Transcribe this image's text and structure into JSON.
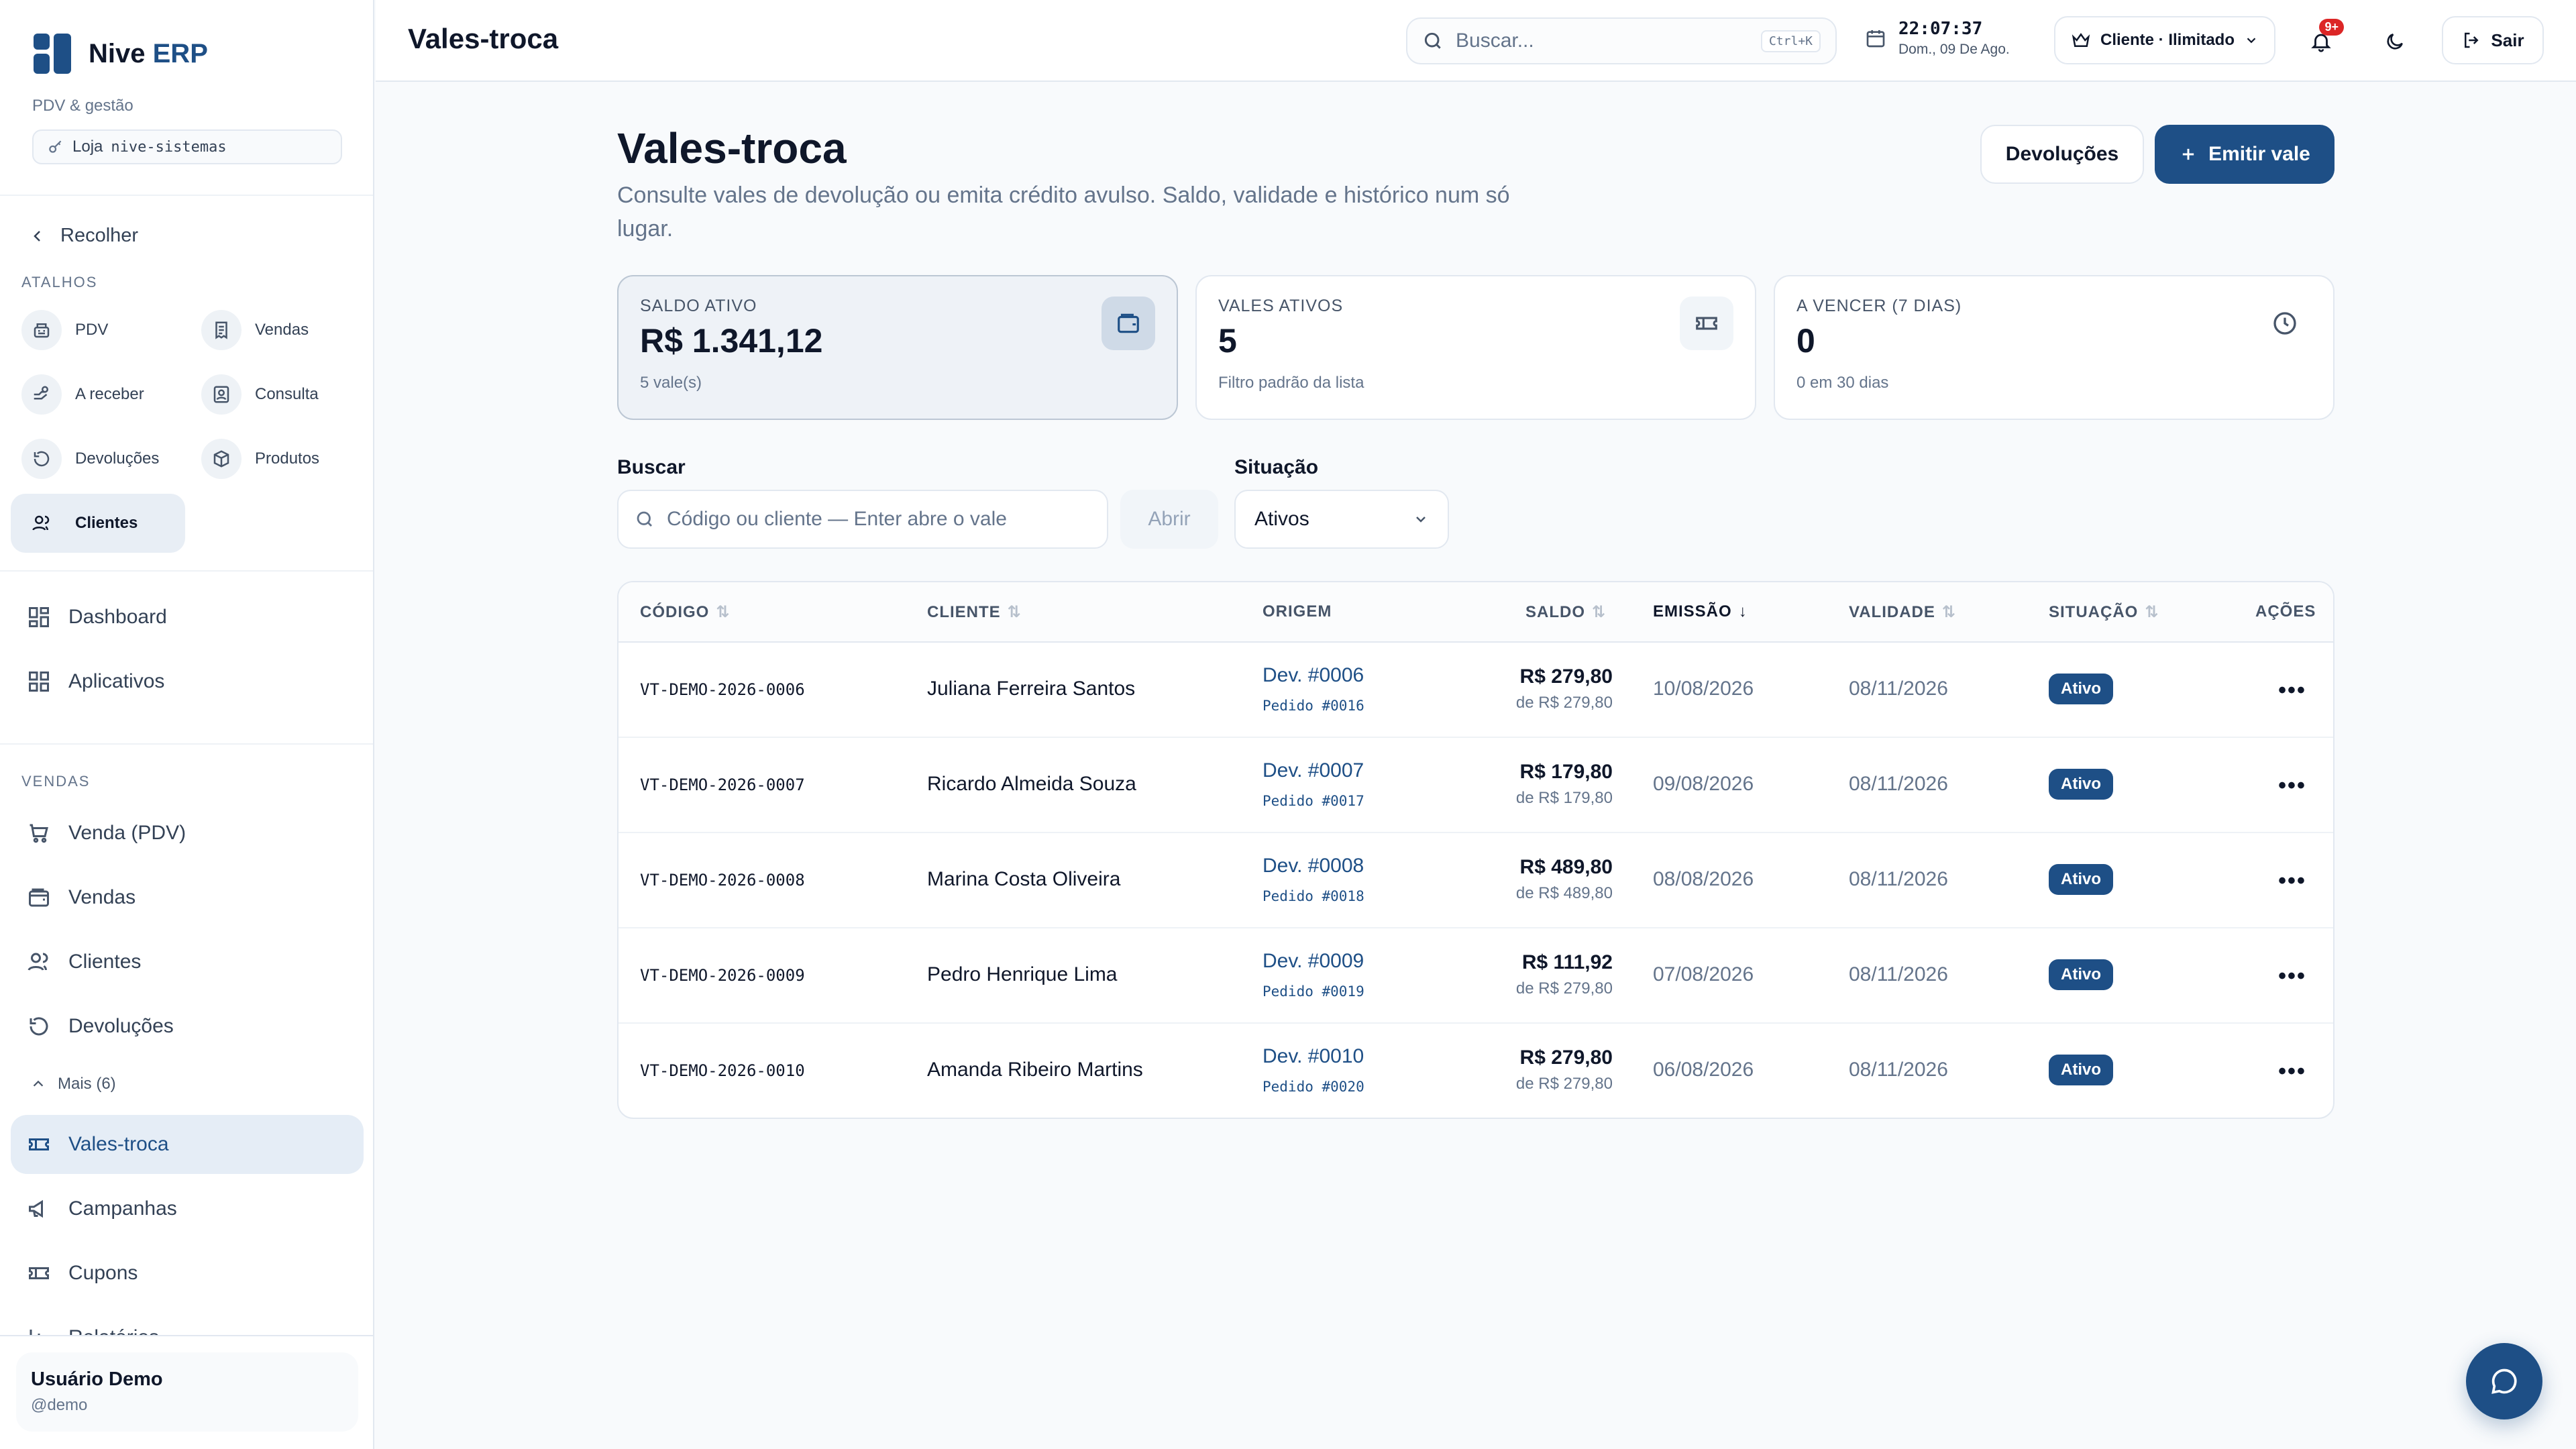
{
  "brand": {
    "name": "Nive",
    "name_accent": "ERP",
    "subtitle": "PDV & gestão",
    "store_label": "Loja",
    "store_value": "nive-sistemas"
  },
  "sidebar": {
    "collapse_label": "Recolher",
    "shortcuts_label": "ATALHOS",
    "shortcuts": [
      {
        "label": "PDV",
        "icon": "register-icon"
      },
      {
        "label": "Vendas",
        "icon": "receipt-icon"
      },
      {
        "label": "A receber",
        "icon": "money-icon"
      },
      {
        "label": "Consulta",
        "icon": "badge-icon"
      },
      {
        "label": "Devoluções",
        "icon": "return-icon"
      },
      {
        "label": "Produtos",
        "icon": "box-icon"
      },
      {
        "label": "Clientes",
        "icon": "users-icon",
        "active": true
      }
    ],
    "main_nav": [
      {
        "label": "Dashboard"
      },
      {
        "label": "Aplicativos"
      }
    ],
    "sales_label": "VENDAS",
    "sales_nav": [
      {
        "label": "Venda (PDV)"
      },
      {
        "label": "Vendas"
      },
      {
        "label": "Clientes"
      },
      {
        "label": "Devoluções"
      }
    ],
    "more_label": "Mais (6)",
    "more_nav": [
      {
        "label": "Vales-troca",
        "active": true
      },
      {
        "label": "Campanhas"
      },
      {
        "label": "Cupons"
      },
      {
        "label": "Relatórios"
      }
    ],
    "user": {
      "name": "Usuário Demo",
      "handle": "@demo"
    }
  },
  "topbar": {
    "title": "Vales-troca",
    "search_placeholder": "Buscar...",
    "search_shortcut": "Ctrl+K",
    "time": "22:07:37",
    "date": "Dom., 09 De Ago.",
    "plan": "Cliente · Ilimitado",
    "notifications_badge": "9+",
    "logout": "Sair"
  },
  "page": {
    "title": "Vales-troca",
    "subtitle": "Consulte vales de devolução ou emita crédito avulso. Saldo, validade e histórico num só lugar.",
    "btn_returns": "Devoluções",
    "btn_issue": "Emitir vale"
  },
  "cards": [
    {
      "label": "SALDO ATIVO",
      "value": "R$ 1.341,12",
      "note": "5 vale(s)",
      "icon": "wallet-icon"
    },
    {
      "label": "VALES ATIVOS",
      "value": "5",
      "note": "Filtro padrão da lista",
      "icon": "ticket-icon"
    },
    {
      "label": "A VENCER (7 DIAS)",
      "value": "0",
      "note": "0 em 30 dias",
      "icon": "clock-icon"
    }
  ],
  "filters": {
    "search_label": "Buscar",
    "search_placeholder": "Código ou cliente — Enter abre o vale",
    "open_label": "Abrir",
    "status_label": "Situação",
    "status_value": "Ativos"
  },
  "table": {
    "headers": {
      "code": "CÓDIGO",
      "client": "CLIENTE",
      "origin": "ORIGEM",
      "balance": "SALDO",
      "issued": "EMISSÃO",
      "validity": "VALIDADE",
      "status": "SITUAÇÃO",
      "actions": "AÇÕES"
    },
    "rows": [
      {
        "code": "VT-DEMO-2026-0006",
        "client": "Juliana Ferreira Santos",
        "origin": "Dev. #0006",
        "order": "Pedido #0016",
        "balance": "R$ 279,80",
        "original": "de R$ 279,80",
        "issued": "10/08/2026",
        "validity": "08/11/2026",
        "status": "Ativo"
      },
      {
        "code": "VT-DEMO-2026-0007",
        "client": "Ricardo Almeida Souza",
        "origin": "Dev. #0007",
        "order": "Pedido #0017",
        "balance": "R$ 179,80",
        "original": "de R$ 179,80",
        "issued": "09/08/2026",
        "validity": "08/11/2026",
        "status": "Ativo"
      },
      {
        "code": "VT-DEMO-2026-0008",
        "client": "Marina Costa Oliveira",
        "origin": "Dev. #0008",
        "order": "Pedido #0018",
        "balance": "R$ 489,80",
        "original": "de R$ 489,80",
        "issued": "08/08/2026",
        "validity": "08/11/2026",
        "status": "Ativo"
      },
      {
        "code": "VT-DEMO-2026-0009",
        "client": "Pedro Henrique Lima",
        "origin": "Dev. #0009",
        "order": "Pedido #0019",
        "balance": "R$ 111,92",
        "original": "de R$ 279,80",
        "issued": "07/08/2026",
        "validity": "08/11/2026",
        "status": "Ativo"
      },
      {
        "code": "VT-DEMO-2026-0010",
        "client": "Amanda Ribeiro Martins",
        "origin": "Dev. #0010",
        "order": "Pedido #0020",
        "balance": "R$ 279,80",
        "original": "de R$ 279,80",
        "issued": "06/08/2026",
        "validity": "08/11/2026",
        "status": "Ativo"
      }
    ]
  },
  "colors": {
    "accent": "#1e4f86",
    "danger": "#dc2626",
    "muted": "#64748b",
    "border": "#e2e8f0"
  }
}
